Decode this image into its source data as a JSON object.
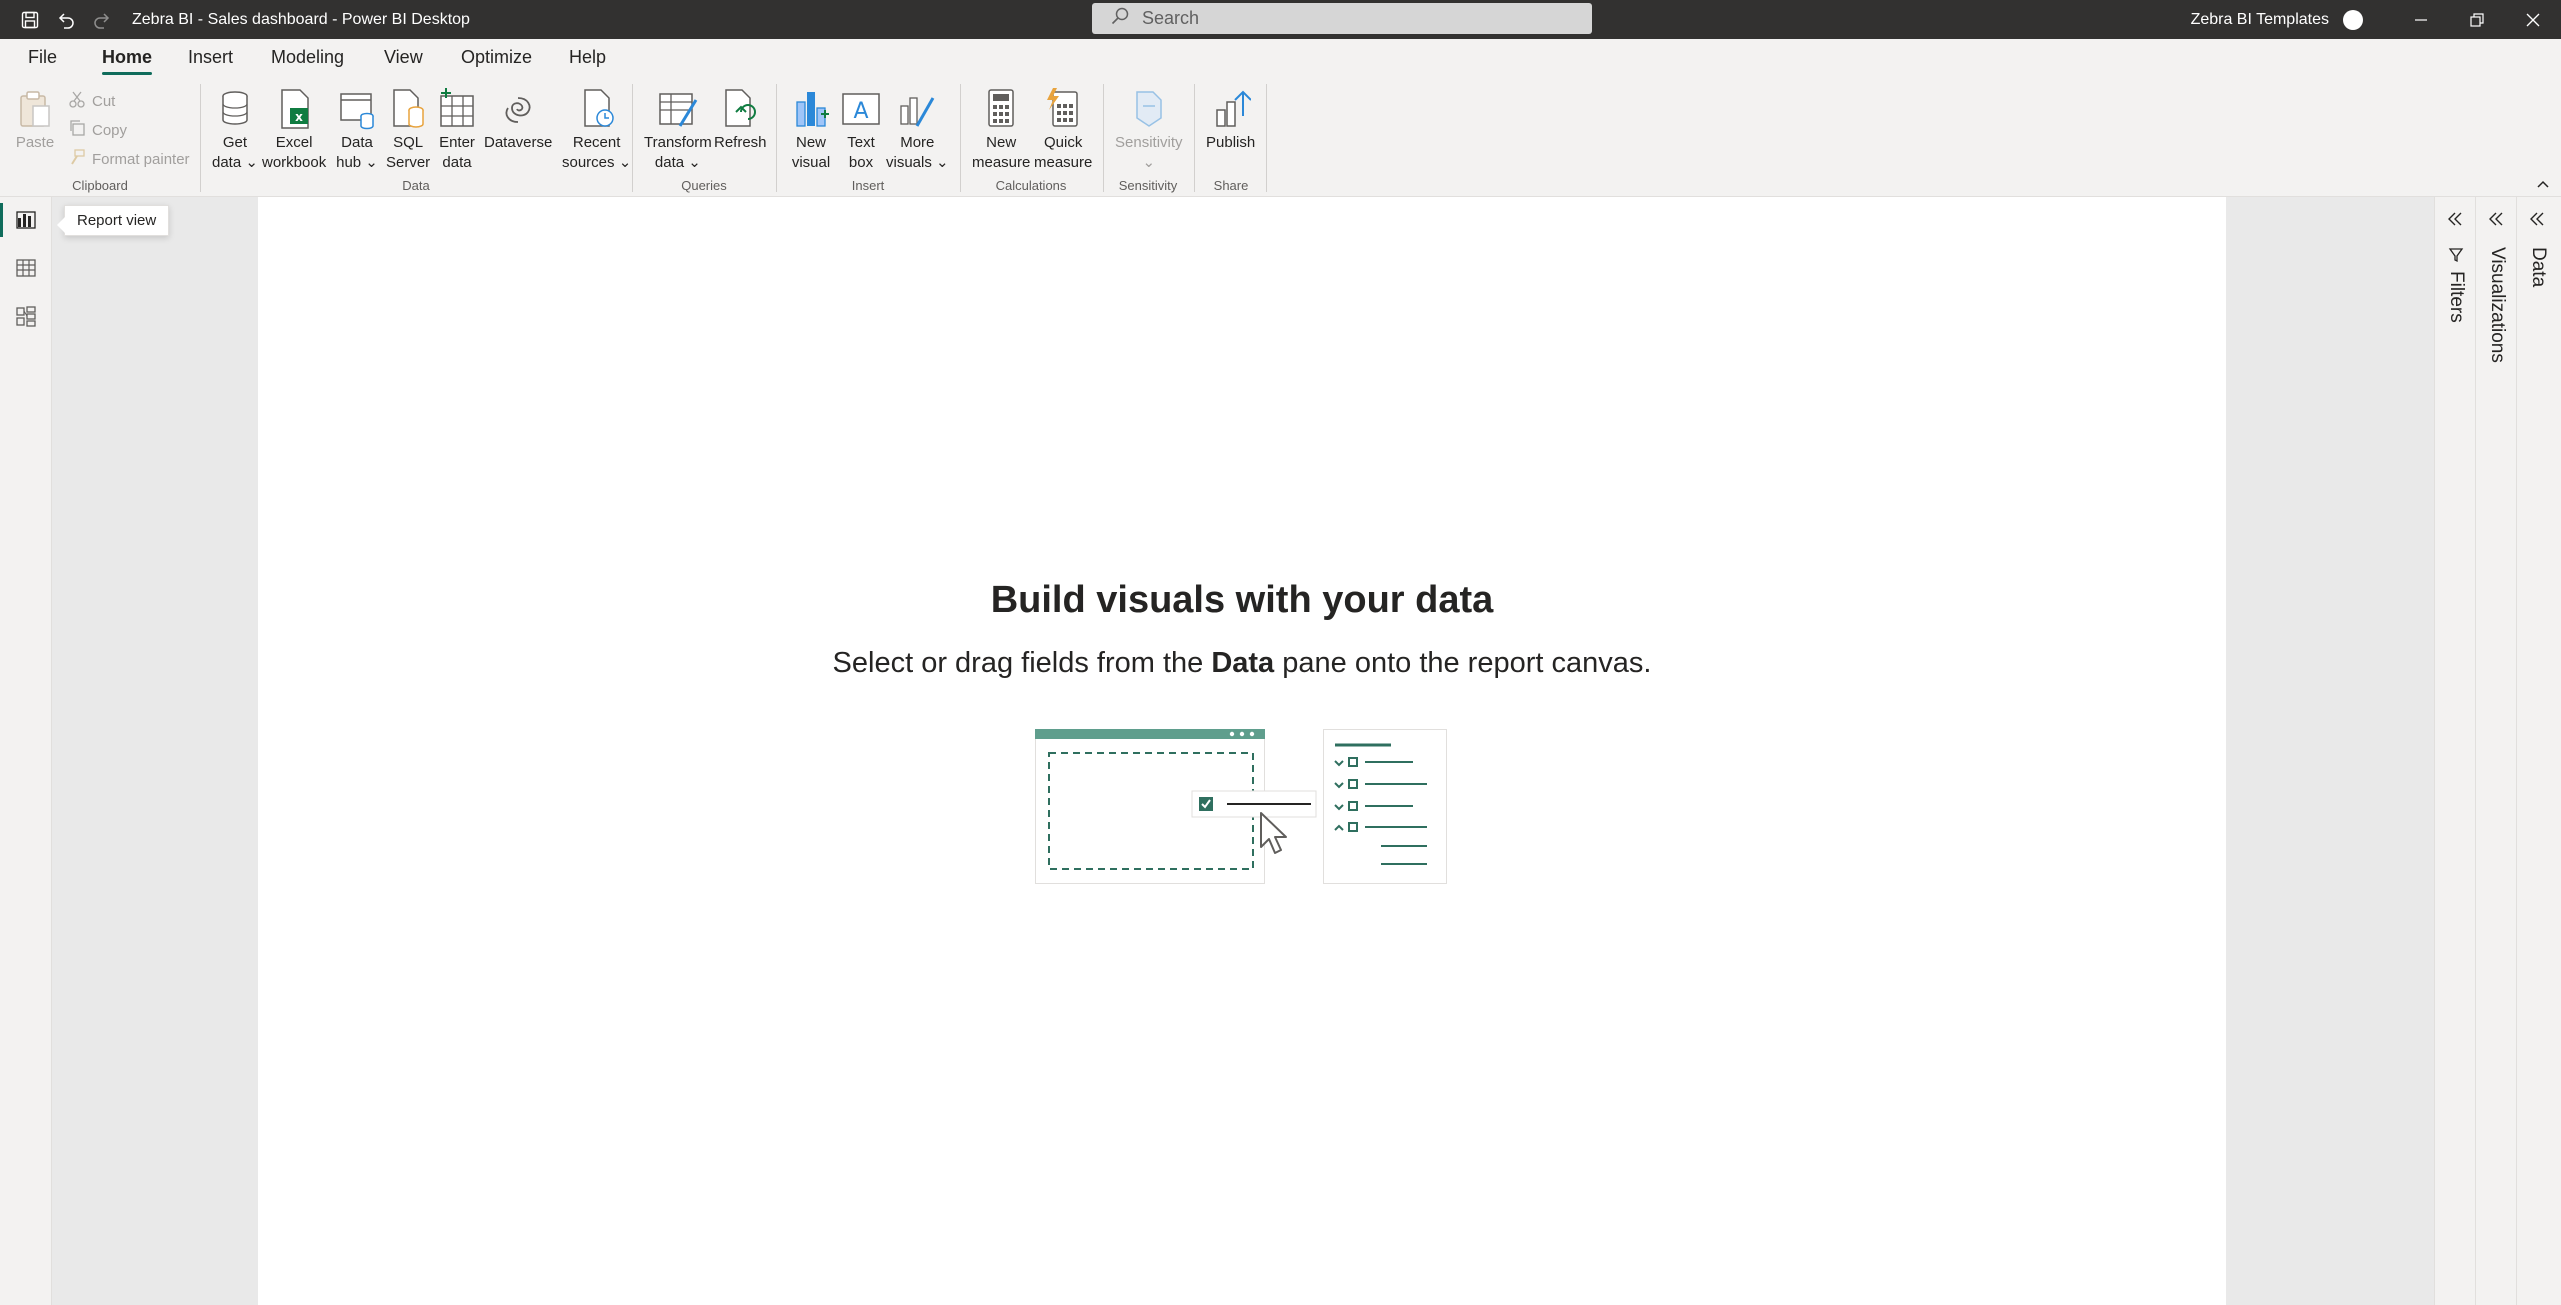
{
  "titlebar": {
    "title": "Zebra BI - Sales dashboard - Power BI Desktop",
    "search_placeholder": "Search",
    "user": "Zebra BI Templates",
    "icons": [
      "save-icon",
      "undo-icon",
      "redo-icon",
      "search-icon",
      "minimize-icon",
      "restore-icon",
      "close-icon"
    ]
  },
  "menu": {
    "tabs": [
      "File",
      "Home",
      "Insert",
      "Modeling",
      "View",
      "Optimize",
      "Help"
    ],
    "active": "Home"
  },
  "ribbon": {
    "clipboard": {
      "paste": "Paste",
      "cut": "Cut",
      "copy": "Copy",
      "format_painter": "Format painter",
      "label": "Clipboard"
    },
    "data": {
      "get_data": [
        "Get",
        "data"
      ],
      "excel": [
        "Excel",
        "workbook"
      ],
      "data_hub": [
        "Data",
        "hub"
      ],
      "sql": [
        "SQL",
        "Server"
      ],
      "enter_data": [
        "Enter",
        "data"
      ],
      "dataverse": [
        "Dataverse"
      ],
      "recent": [
        "Recent",
        "sources"
      ],
      "label": "Data"
    },
    "queries": {
      "transform": [
        "Transform",
        "data"
      ],
      "refresh": [
        "Refresh"
      ],
      "label": "Queries"
    },
    "insert": {
      "new_visual": [
        "New",
        "visual"
      ],
      "text_box": [
        "Text",
        "box"
      ],
      "more_visuals": [
        "More",
        "visuals"
      ],
      "label": "Insert"
    },
    "calculations": {
      "new_measure": [
        "New",
        "measure"
      ],
      "quick_measure": [
        "Quick",
        "measure"
      ],
      "label": "Calculations"
    },
    "sensitivity": {
      "sensitivity": [
        "Sensitivity"
      ],
      "label": "Sensitivity"
    },
    "share": {
      "publish": [
        "Publish"
      ],
      "label": "Share"
    }
  },
  "leftnav": {
    "tooltip": "Report view",
    "items": [
      "report-view",
      "table-view",
      "model-view"
    ]
  },
  "canvas": {
    "title": "Build visuals with your data",
    "sub_before": "Select or drag fields from the ",
    "sub_bold": "Data",
    "sub_after": " pane onto the report canvas."
  },
  "panes": {
    "filters": "Filters",
    "visualizations": "Visualizations",
    "data": "Data"
  },
  "colors": {
    "accent": "#0f6c5b",
    "titlebar": "#323130",
    "ribbon": "#f3f2f1"
  }
}
